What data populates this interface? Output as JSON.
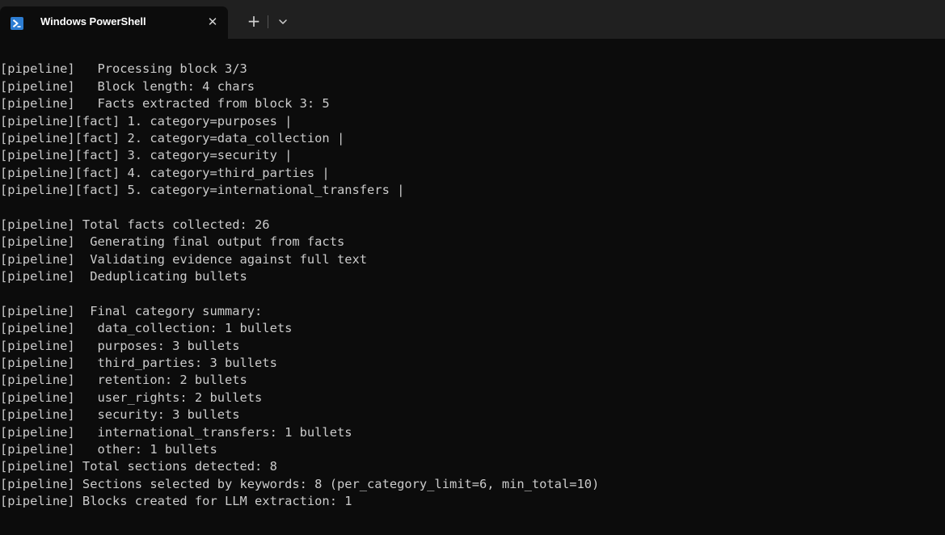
{
  "window": {
    "tab_title": "Windows PowerShell",
    "tab_icon": "powershell-icon",
    "close_icon": "close-icon",
    "new_tab_icon": "plus-icon",
    "dropdown_icon": "chevron-down-icon"
  },
  "colors": {
    "background": "#0c0c0c",
    "titlebar": "#202020",
    "text": "#cccccc",
    "icon": "#2d7dd2"
  },
  "console": {
    "lines": [
      "",
      "[pipeline]   Processing block 3/3",
      "[pipeline]   Block length: 4 chars",
      "[pipeline]   Facts extracted from block 3: 5",
      "[pipeline][fact] 1. category=purposes |",
      "[pipeline][fact] 2. category=data_collection |",
      "[pipeline][fact] 3. category=security |",
      "[pipeline][fact] 4. category=third_parties |",
      "[pipeline][fact] 5. category=international_transfers |",
      "",
      "[pipeline] Total facts collected: 26",
      "[pipeline]  Generating final output from facts",
      "[pipeline]  Validating evidence against full text",
      "[pipeline]  Deduplicating bullets",
      "",
      "[pipeline]  Final category summary:",
      "[pipeline]   data_collection: 1 bullets",
      "[pipeline]   purposes: 3 bullets",
      "[pipeline]   third_parties: 3 bullets",
      "[pipeline]   retention: 2 bullets",
      "[pipeline]   user_rights: 2 bullets",
      "[pipeline]   security: 3 bullets",
      "[pipeline]   international_transfers: 1 bullets",
      "[pipeline]   other: 1 bullets",
      "[pipeline] Total sections detected: 8",
      "[pipeline] Sections selected by keywords: 8 (per_category_limit=6, min_total=10)",
      "[pipeline] Blocks created for LLM extraction: 1"
    ]
  }
}
